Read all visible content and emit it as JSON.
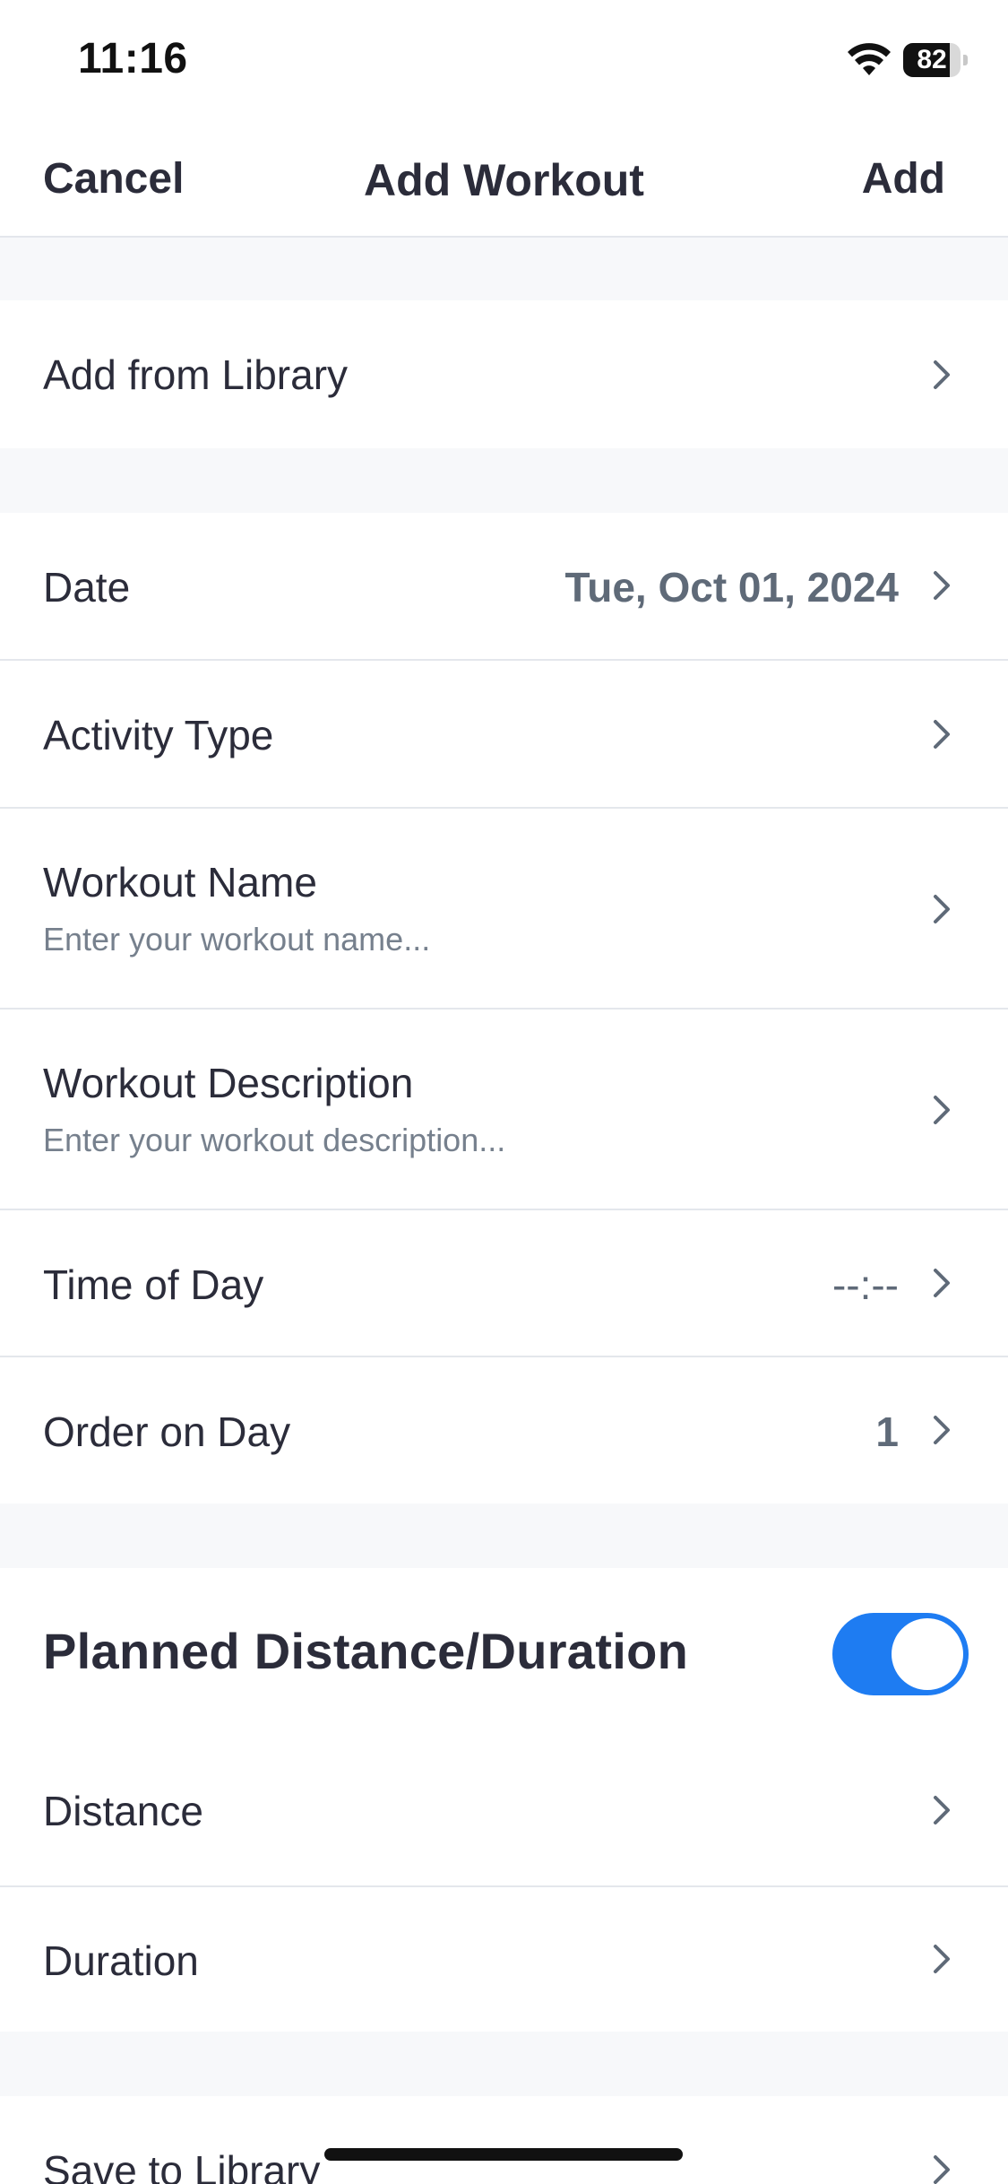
{
  "status_bar": {
    "time": "11:16",
    "battery_level": "82",
    "battery_fraction": 0.82
  },
  "nav": {
    "cancel_label": "Cancel",
    "title": "Add Workout",
    "add_label": "Add"
  },
  "rows": {
    "add_from_library": {
      "label": "Add from Library"
    },
    "date": {
      "label": "Date",
      "value": "Tue, Oct 01, 2024"
    },
    "activity_type": {
      "label": "Activity Type"
    },
    "workout_name": {
      "label": "Workout Name",
      "placeholder": "Enter your workout name..."
    },
    "workout_description": {
      "label": "Workout Description",
      "placeholder": "Enter your workout description..."
    },
    "time_of_day": {
      "label": "Time of Day",
      "value": "--:--"
    },
    "order_on_day": {
      "label": "Order on Day",
      "value": "1"
    }
  },
  "planned": {
    "title": "Planned Distance/Duration",
    "toggle_on": true,
    "distance_label": "Distance",
    "duration_label": "Duration"
  },
  "library": {
    "save_label": "Save to Library"
  },
  "colors": {
    "accent": "#1e7cf2",
    "text_primary": "#2b2c3a",
    "text_secondary": "#76808d",
    "value_text": "#5f6a78",
    "section_gap": "#f7f8fa",
    "divider": "#e4e7ec"
  },
  "icons": {
    "chevron": "chevron-right-icon",
    "wifi": "wifi-icon",
    "battery": "battery-icon"
  }
}
